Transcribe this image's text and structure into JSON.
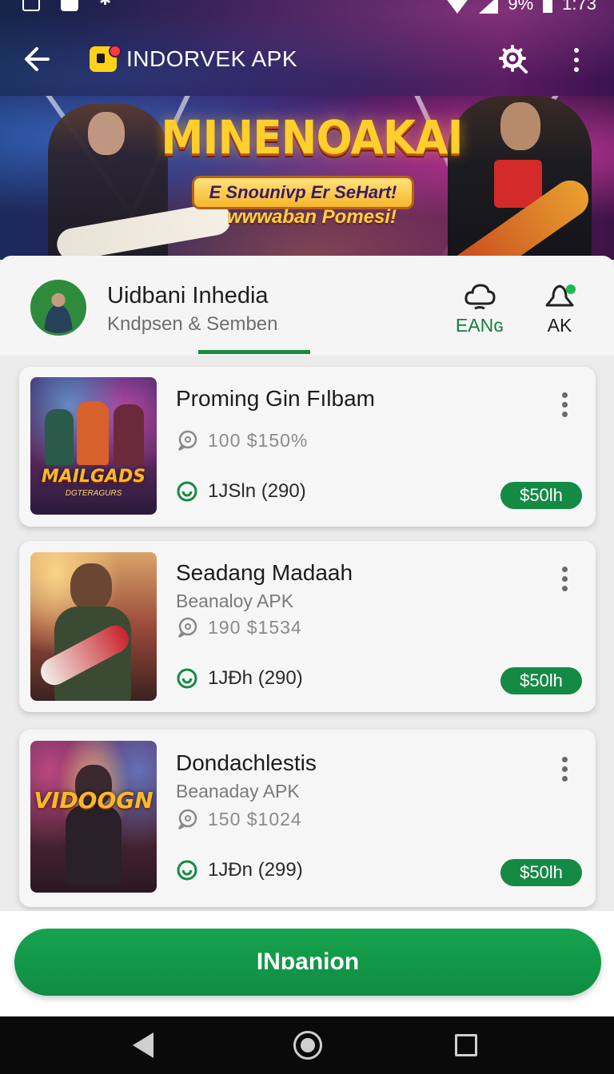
{
  "status_bar": {
    "battery_text": "9%",
    "time": "1:73"
  },
  "app_bar": {
    "title": "INDORVEK APK"
  },
  "banner": {
    "title": "MINENOAKAI",
    "ribbon": "E Snounivp Er SeHart!",
    "tagline": "wwwaban Pomesi!"
  },
  "profile": {
    "name": "Uidbani Inhedia",
    "subtitle": "Kndpsen & Semben",
    "stats": [
      {
        "label": "EANɢ",
        "icon": "cloud-icon"
      },
      {
        "label": "AK",
        "icon": "cloud-notification-icon"
      }
    ]
  },
  "apps": [
    {
      "title": "Proming Gin Fılbam",
      "subtitle": "",
      "thumb_text": "MAILGADS",
      "thumb_sub": "DGTERAGURS",
      "stats": "100 $150%",
      "rating": "1JSln (290)",
      "price": "$50lh"
    },
    {
      "title": "Seadang Madaah",
      "subtitle": "Beanaloy APK",
      "thumb_text": "",
      "thumb_sub": "",
      "stats": "190 $1534",
      "rating": "1JÐh (290)",
      "price": "$50lh"
    },
    {
      "title": "Dondachlestis",
      "subtitle": "Beanaday APK",
      "thumb_text": "VIDOOGN",
      "thumb_sub": "",
      "stats": "150 $1024",
      "rating": "1JÐn (299)",
      "price": "$50lh"
    }
  ],
  "cta": {
    "label": "INɒanion"
  },
  "colors": {
    "accent": "#148a44",
    "header": "#2a1b52",
    "banner_gold": "#ffcf2b"
  }
}
